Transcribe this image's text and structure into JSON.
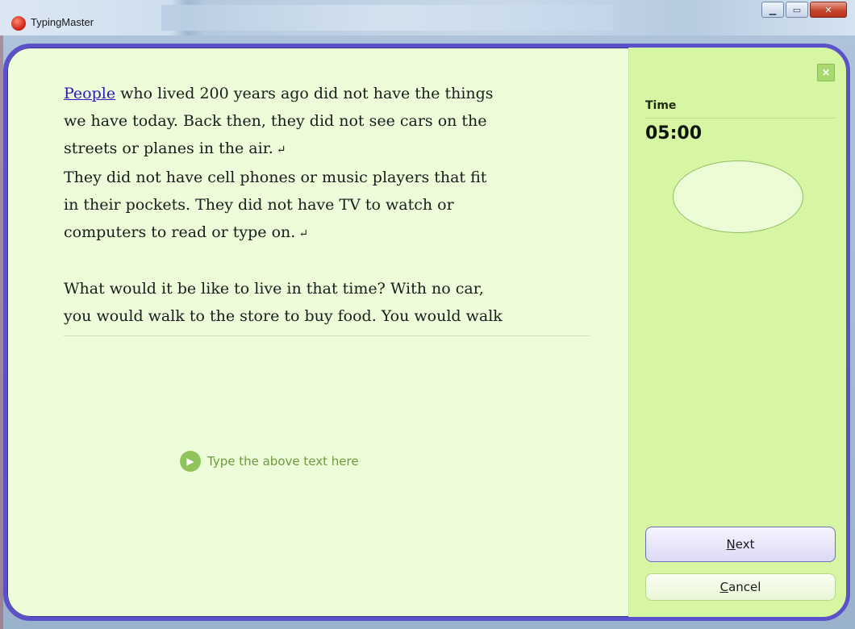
{
  "window": {
    "title": "TypingMaster",
    "controls": {
      "minimize": "▁",
      "maximize": "▭",
      "close": "✕"
    }
  },
  "lesson": {
    "current_word": "People",
    "lines": [
      " who lived 200 years ago did not have the things",
      "we have today. Back then, they did not see cars on the",
      "streets or planes in the air.",
      "They did not have cell phones or music players that fit",
      "in their pockets. They did not have TV to watch or",
      "computers to read or type on.",
      "",
      "What would it be like to live in that time? With no car,",
      "you would walk to the store to buy food. You would walk"
    ],
    "return_mark": "↵",
    "type_hint": "Type the above text here"
  },
  "side_panel": {
    "close_symbol": "×",
    "time_label": "Time",
    "time_value": "05:00",
    "next_button": {
      "prefix": "",
      "accel": "N",
      "rest": "ext"
    },
    "cancel_button": {
      "prefix": "",
      "accel": "C",
      "rest": "ancel"
    }
  },
  "icons": {
    "app_logo": "typingmaster-logo-icon",
    "play": "play-icon",
    "close": "close-icon"
  },
  "colors": {
    "dialog_border": "#5b52c9",
    "text_area_bg": "#eefdd9",
    "side_panel_bg": "#d6f6a3",
    "current_word": "#2c1bb8"
  }
}
